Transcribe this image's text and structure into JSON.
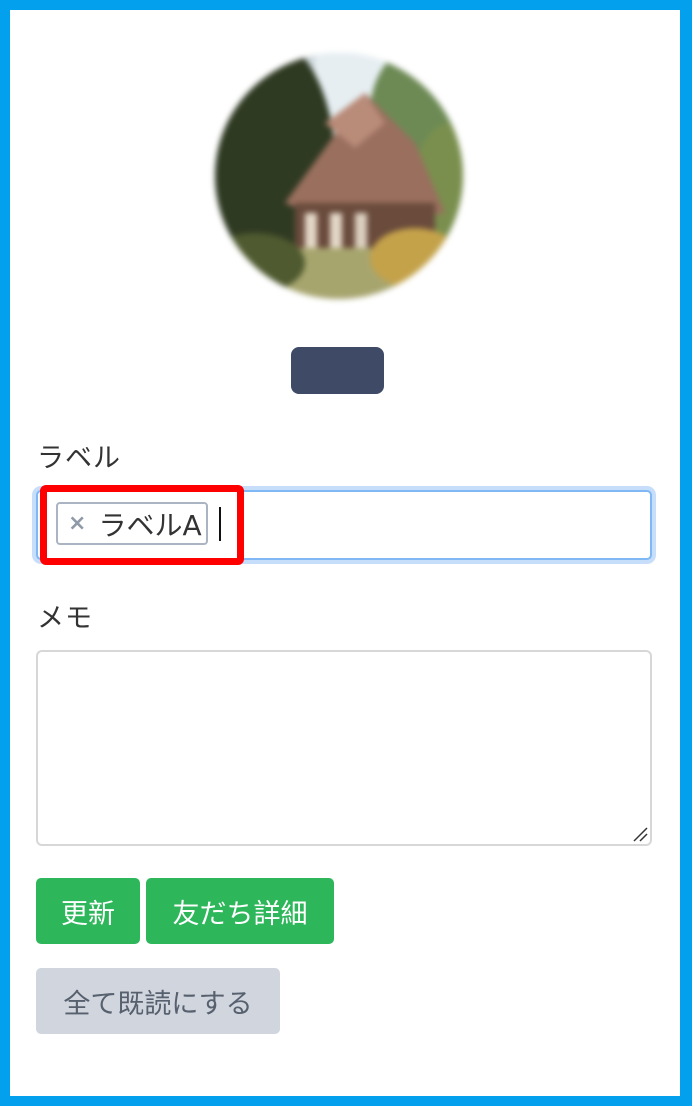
{
  "form": {
    "label_heading": "ラベル",
    "memo_heading": "メモ",
    "tag_remove_symbol": "×",
    "tags": [
      {
        "label": "ラベルA"
      }
    ],
    "memo_value": ""
  },
  "buttons": {
    "update": "更新",
    "friend_detail": "友だち詳細",
    "mark_all_read": "全て既読にする"
  },
  "colors": {
    "frame_border": "#03a0ee",
    "name_pill": "#3e4a66",
    "primary_button": "#2db65a",
    "secondary_button": "#d1d5dd",
    "highlight": "#ff0000",
    "focus_ring": "#80b8f5"
  },
  "icons": {
    "tag_remove": "close-icon",
    "memo_resize": "resize-handle-icon"
  }
}
